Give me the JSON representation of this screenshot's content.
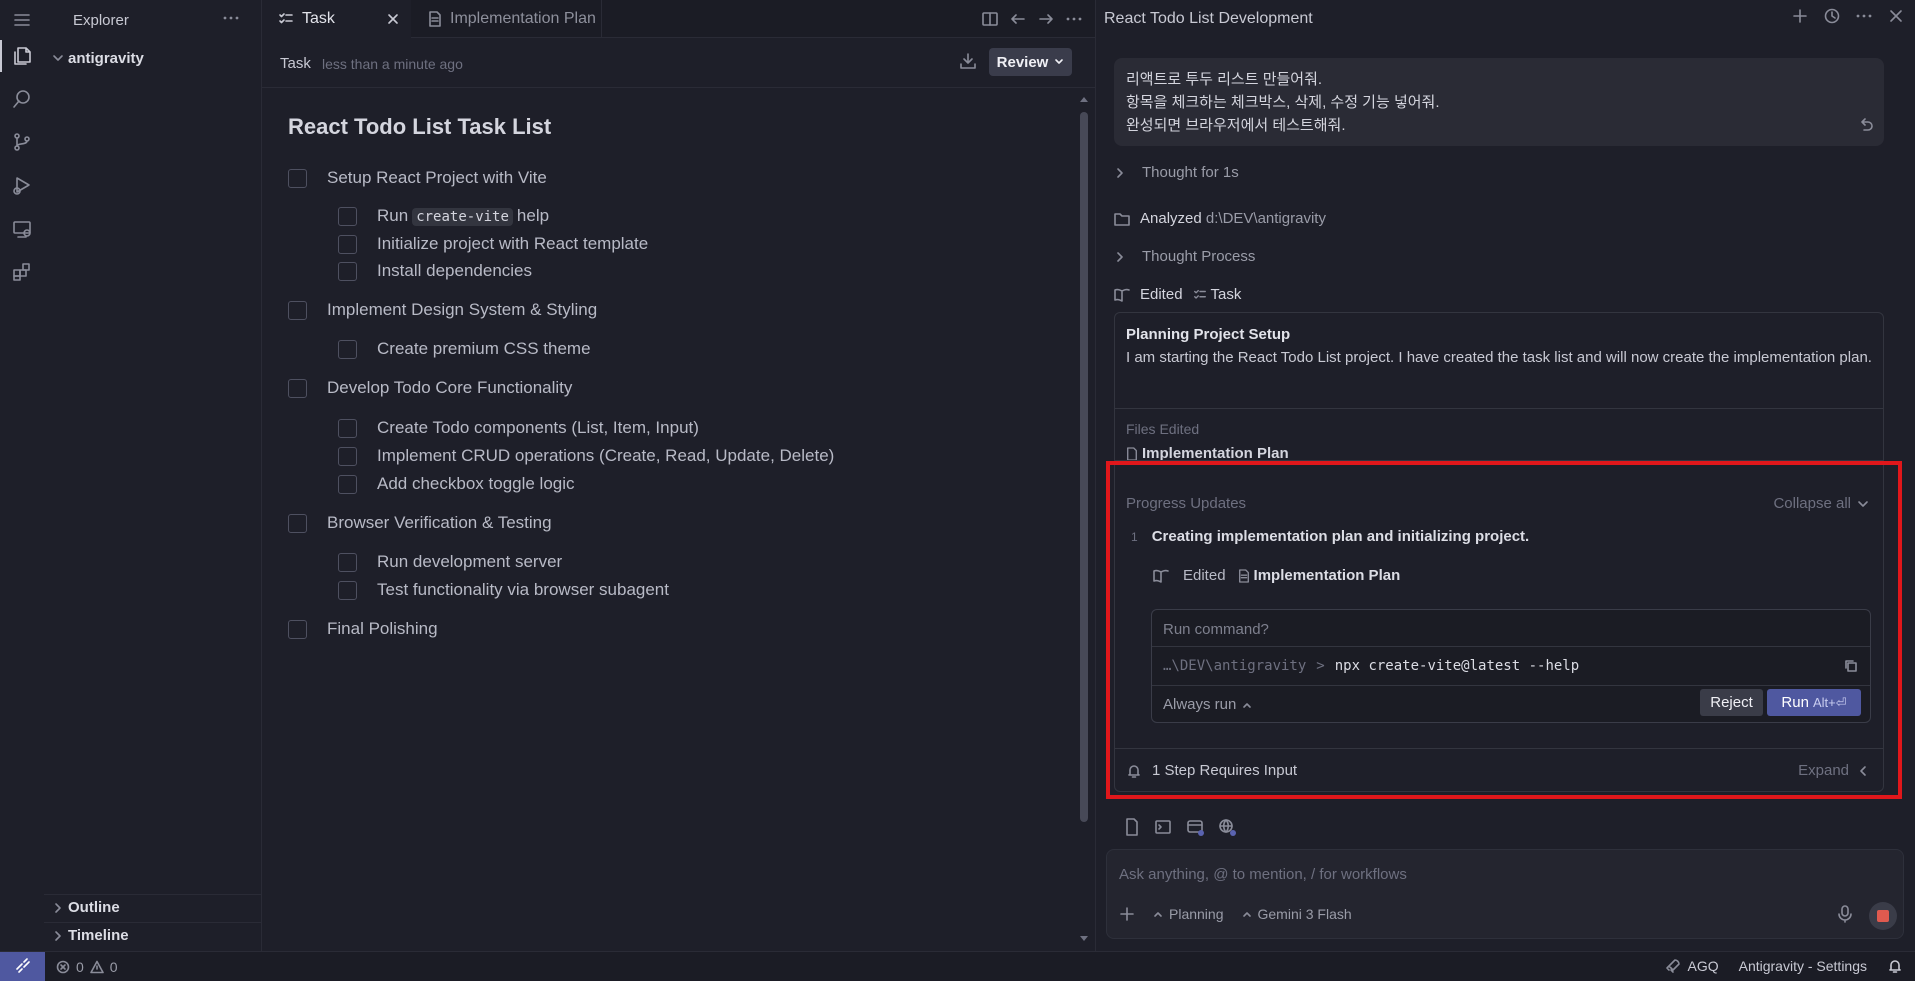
{
  "activity_bar": {
    "items": [
      "menu-icon",
      "explorer-icon",
      "search-icon",
      "source-control-icon",
      "run-debug-icon",
      "remote-explorer-icon",
      "extensions-icon"
    ]
  },
  "sidebar": {
    "title": "Explorer",
    "root_folder": "antigravity",
    "sections": [
      "Outline",
      "Timeline"
    ]
  },
  "editor": {
    "tabs": [
      {
        "label": "Task",
        "active": true
      },
      {
        "label": "Implementation Plan",
        "active": false
      }
    ],
    "breadcrumb": {
      "name": "Task",
      "time": "less than a minute ago"
    },
    "review_label": "Review",
    "doc_title": "React Todo List Task List",
    "tasks": [
      {
        "text": "Setup React Project with Vite",
        "level": 0
      },
      {
        "pre": "Run",
        "code": "create-vite",
        "post": "help",
        "level": 1
      },
      {
        "text": "Initialize project with React template",
        "level": 1
      },
      {
        "text": "Install dependencies",
        "level": 1
      },
      {
        "text": "Implement Design System & Styling",
        "level": 0
      },
      {
        "text": "Create premium CSS theme",
        "level": 1
      },
      {
        "text": "Develop Todo Core Functionality",
        "level": 0
      },
      {
        "text": "Create Todo components (List, Item, Input)",
        "level": 1
      },
      {
        "text": "Implement CRUD operations (Create, Read, Update, Delete)",
        "level": 1
      },
      {
        "text": "Add checkbox toggle logic",
        "level": 1
      },
      {
        "text": "Browser Verification & Testing",
        "level": 0
      },
      {
        "text": "Run development server",
        "level": 1
      },
      {
        "text": "Test functionality via browser subagent",
        "level": 1
      },
      {
        "text": "Final Polishing",
        "level": 0
      }
    ]
  },
  "agent": {
    "title": "React Todo List Development",
    "user_message": [
      "리액트로 투두 리스트 만들어줘.",
      "항목을 체크하는 체크박스, 삭제, 수정 기능 넣어줘.",
      "완성되면 브라우저에서 테스트해줘."
    ],
    "thought1": "Thought for 1s",
    "analyzed_label": "Analyzed",
    "analyzed_path": "d:\\DEV\\antigravity",
    "thought2": "Thought Process",
    "edited_label": "Edited",
    "edited_file": "Task",
    "card": {
      "heading": "Planning Project Setup",
      "body": "I am starting the React Todo List project. I have created the task list and will now create the implementation plan.",
      "files_edited_label": "Files Edited",
      "files_edited_item": "Implementation Plan",
      "progress_label": "Progress Updates",
      "collapse_label": "Collapse all",
      "update_num": "1",
      "update_text": "Creating implementation plan and initializing project.",
      "update_edited_label": "Edited",
      "update_edited_file": "Implementation Plan",
      "command_prompt": "Run command?",
      "command_path": "…\\DEV\\antigravity",
      "command_sep": ">",
      "command": "npx create-vite@latest --help",
      "always_run": "Always run",
      "reject_label": "Reject",
      "run_label": "Run",
      "run_shortcut": "Alt+⏎",
      "requires_input": "1 Step Requires Input",
      "expand_label": "Expand"
    },
    "composer": {
      "placeholder": "Ask anything, @ to mention, / for workflows",
      "mode": "Planning",
      "model": "Gemini 3 Flash"
    }
  },
  "status_bar": {
    "errors": "0",
    "warnings": "0",
    "agq": "AGQ",
    "settings": "Antigravity - Settings"
  },
  "colors": {
    "accent": "#4f58a0",
    "highlight_border": "#e0171b",
    "stop": "#e05a4f"
  }
}
